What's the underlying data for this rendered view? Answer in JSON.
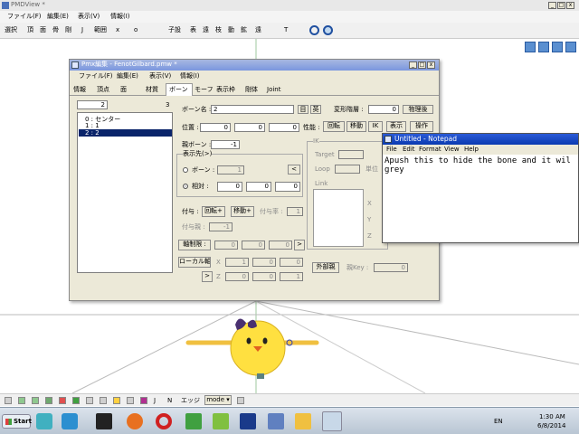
{
  "app": {
    "title": "PMDView *",
    "menu": [
      "ファイル(F)",
      "編集(E)",
      "表示(V)",
      "情報(I)"
    ],
    "toolbar": [
      "選択",
      "頂",
      "面",
      "骨",
      "剛",
      "J",
      "範囲",
      "x",
      "o",
      "子設",
      "表",
      "遠",
      "枝",
      "動",
      "鉱",
      "遠",
      "T"
    ]
  },
  "pmx": {
    "title": "Pmx編集 - FenotGilbard.pmw *",
    "menu": [
      "ファイル(F)",
      "編集(E)",
      "表示(V)",
      "情報(I)"
    ],
    "tabs": [
      "情報",
      "頂点",
      "面",
      "材質",
      "ボーン",
      "モーフ",
      "表示枠",
      "剛体",
      "Joint"
    ],
    "list_index": "2",
    "list_count": "3",
    "bones": [
      "0 : センター",
      "1 : 1",
      "2 : 2"
    ],
    "bone_name_label": "ボーン名 :",
    "bone_name_value": "2",
    "name_btn_1": "目",
    "name_btn_2": "英",
    "deform_label": "変形階層 :",
    "deform_value": "0",
    "physics_label": "物理後",
    "position_label": "位置 :",
    "position": [
      "0",
      "0",
      "0"
    ],
    "perf_label": "性能 :",
    "perf_buttons": [
      "回転",
      "移動",
      "IK",
      "表示",
      "操作"
    ],
    "parent_label": "親ボーン :",
    "parent_value": "-1",
    "display_group_label": "表示先(>)",
    "radio_bone": "ボーン :",
    "radio_bone_value": "1",
    "radio_relative": "相対 :",
    "relative": [
      "0",
      "0",
      "0"
    ],
    "ik_label": "IK",
    "ik_target": "Target",
    "ik_loop": "Loop",
    "ik_unit": "単位",
    "ik_link": "Link",
    "xyz": [
      "X",
      "Y",
      "Z"
    ],
    "inherit_label": "付与 :",
    "inherit_rot": "回転+",
    "inherit_move": "移動+",
    "inherit_rate_label": "付与率 :",
    "inherit_rate": "1",
    "inherit_parent_label": "付与親 :",
    "inherit_parent": "-1",
    "axis_limit": "軸制限 :",
    "axis_values": [
      "0",
      "0",
      "0"
    ],
    "local_axis": "ローカル軸 :",
    "local_x": [
      "1",
      "0",
      "0"
    ],
    "local_z": [
      "0",
      "0",
      "1"
    ],
    "outer_parent": "外部親",
    "parent_key_label": "親Key :",
    "parent_key": "0",
    "nav_left": "<",
    "nav_right": ">"
  },
  "notepad": {
    "title": "Untitled - Notepad",
    "menu": [
      "File",
      "Edit",
      "Format",
      "View",
      "Help"
    ],
    "text": "Apush this to hide the bone and it wil\ngrey"
  },
  "bottombar": {
    "labels": [
      "J",
      "N",
      "エッジ",
      "mode"
    ],
    "mode_value": "mode"
  },
  "taskbar": {
    "start": "Start",
    "lang": "EN",
    "time": "1:30 AM",
    "date": "6/8/2014"
  },
  "colors": {
    "selection": "#0a246a",
    "titlebar_active": "#0a246a",
    "titlebar_inactive": "#7a96df",
    "window_bg": "#ece9d8",
    "taskbar": "#c8d2dc"
  }
}
